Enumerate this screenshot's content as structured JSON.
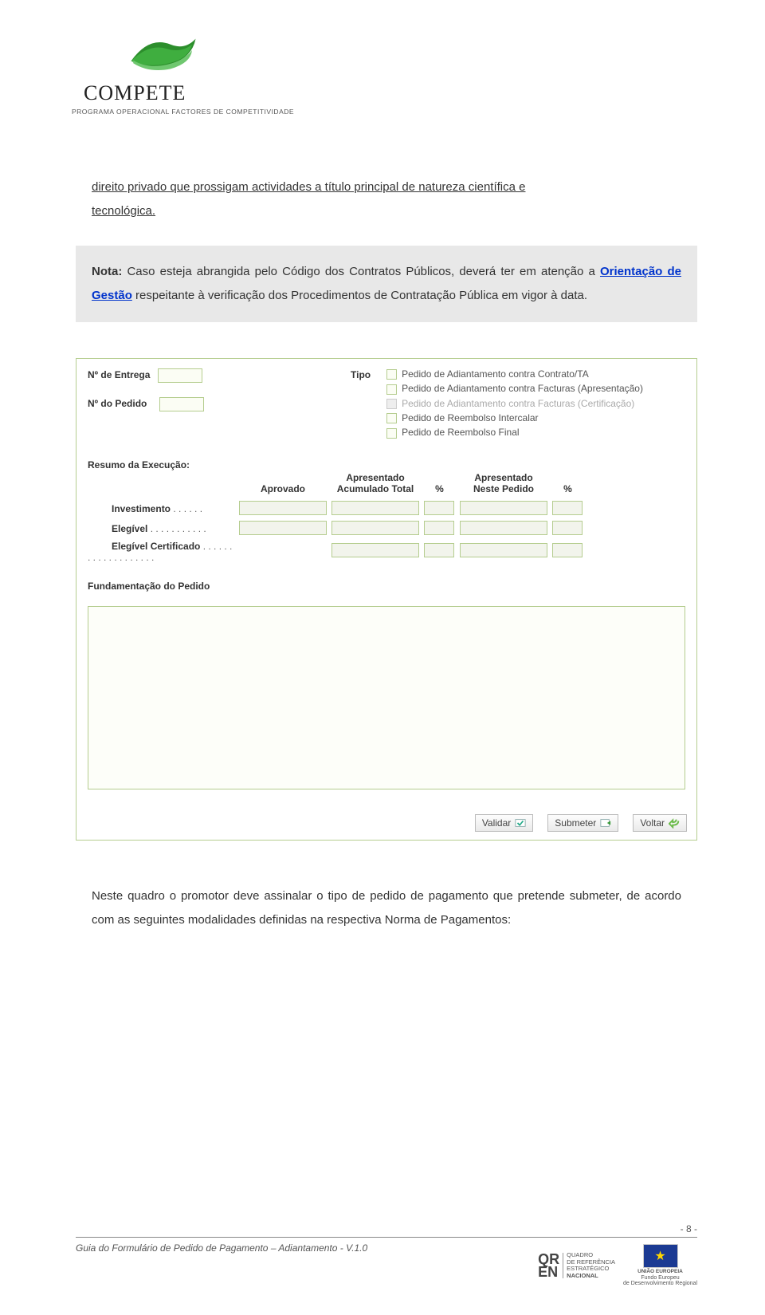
{
  "header": {
    "title": "COMPETE",
    "subtitle": "PROGRAMA OPERACIONAL FACTORES DE COMPETITIVIDADE"
  },
  "paragraph1_a": "direito privado que prossigam actividades a título principal de natureza científica e",
  "paragraph1_b": "tecnológica.",
  "note": {
    "prefix": "Nota:",
    "text1": " Caso esteja abrangida pelo Código dos Contratos Públicos, deverá ter em atenção a ",
    "link": "Orientação de Gestão",
    "text2": " respeitante à verificação dos Procedimentos de Contratação Pública em vigor à data."
  },
  "form": {
    "nentrega": "Nº de Entrega",
    "npedido": "Nº do Pedido",
    "tipo_label": "Tipo",
    "tipo_items": [
      "Pedido de Adiantamento contra Contrato/TA",
      "Pedido de Adiantamento contra Facturas (Apresentação)",
      "Pedido de Adiantamento contra Facturas (Certificação)",
      "Pedido de Reembolso Intercalar",
      "Pedido de Reembolso Final"
    ],
    "resumo_title": "Resumo da Execução:",
    "cols": {
      "aprovado": "Aprovado",
      "apresentado_ac_l1": "Apresentado",
      "apresentado_ac_l2": "Acumulado Total",
      "pct1": "%",
      "apresentado_np_l1": "Apresentado",
      "apresentado_np_l2": "Neste Pedido",
      "pct2": "%"
    },
    "rows": {
      "investimento": "Investimento",
      "elegivel": "Elegível",
      "elegivel_cert": "Elegível Certificado"
    },
    "fundamentacao": "Fundamentação do Pedido",
    "btn_validar": "Validar",
    "btn_submeter": "Submeter",
    "btn_voltar": "Voltar"
  },
  "paragraph2": "Neste quadro o promotor deve assinalar o tipo de pedido de pagamento que pretende submeter, de acordo com as seguintes modalidades definidas na respectiva Norma de Pagamentos:",
  "footer": {
    "left": "Guia do Formulário de Pedido de Pagamento – Adiantamento  -  V.1.0",
    "pagenum": "- 8 -",
    "qren_l": "QR",
    "qren_r": "EN",
    "qren_t1": "QUADRO",
    "qren_t2": "DE REFERÊNCIA",
    "qren_t3": "ESTRATÉGICO",
    "qren_t4": "NACIONAL",
    "eu_l1": "UNIÃO EUROPEIA",
    "eu_l2": "Fundo Europeu",
    "eu_l3": "de Desenvolvimento Regional"
  }
}
